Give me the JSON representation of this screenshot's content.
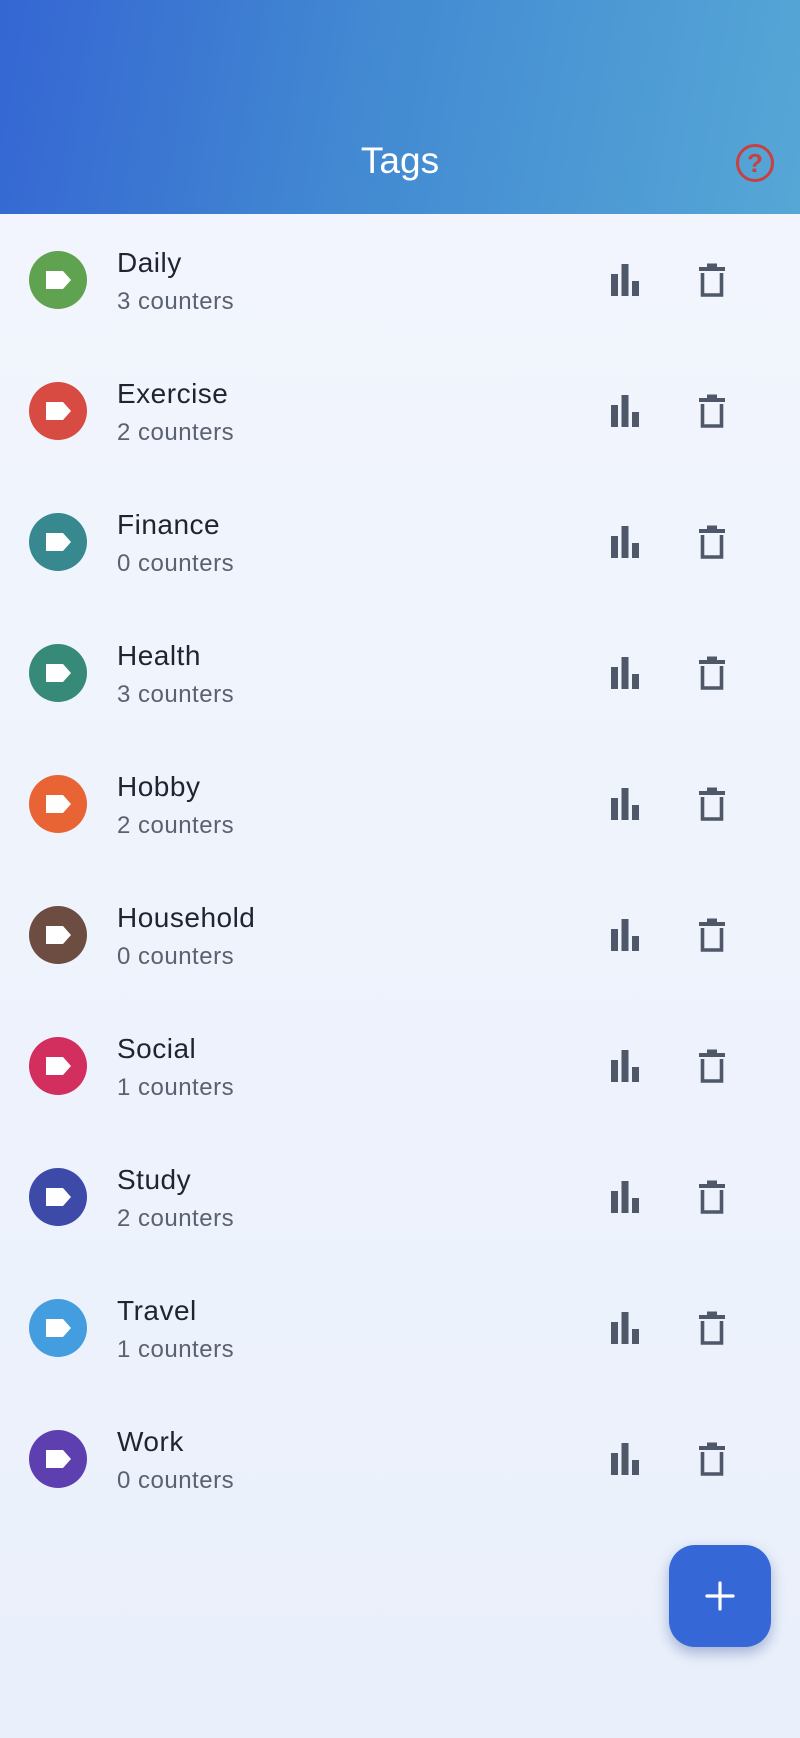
{
  "header": {
    "title": "Tags",
    "help_icon": "help-circle-icon",
    "help_glyph": "?"
  },
  "tags": [
    {
      "name": "Daily",
      "count": "3 counters",
      "color": "#5fa24f"
    },
    {
      "name": "Exercise",
      "count": "2 counters",
      "color": "#d74b42"
    },
    {
      "name": "Finance",
      "count": "0 counters",
      "color": "#388890"
    },
    {
      "name": "Health",
      "count": "3 counters",
      "color": "#388a78"
    },
    {
      "name": "Hobby",
      "count": "2 counters",
      "color": "#e96435"
    },
    {
      "name": "Household",
      "count": "0 counters",
      "color": "#6d4c42"
    },
    {
      "name": "Social",
      "count": "1 counters",
      "color": "#d22f5e"
    },
    {
      "name": "Study",
      "count": "2 counters",
      "color": "#3d4aa7"
    },
    {
      "name": "Travel",
      "count": "1 counters",
      "color": "#449ddf"
    },
    {
      "name": "Work",
      "count": "0 counters",
      "color": "#5e3fb0"
    }
  ],
  "row_actions": {
    "stats_icon": "bar-chart-icon",
    "delete_icon": "trash-icon",
    "tag_icon": "label-icon",
    "icon_color": "#4f5868"
  },
  "fab": {
    "icon": "plus-icon",
    "color": "#3567d6"
  }
}
